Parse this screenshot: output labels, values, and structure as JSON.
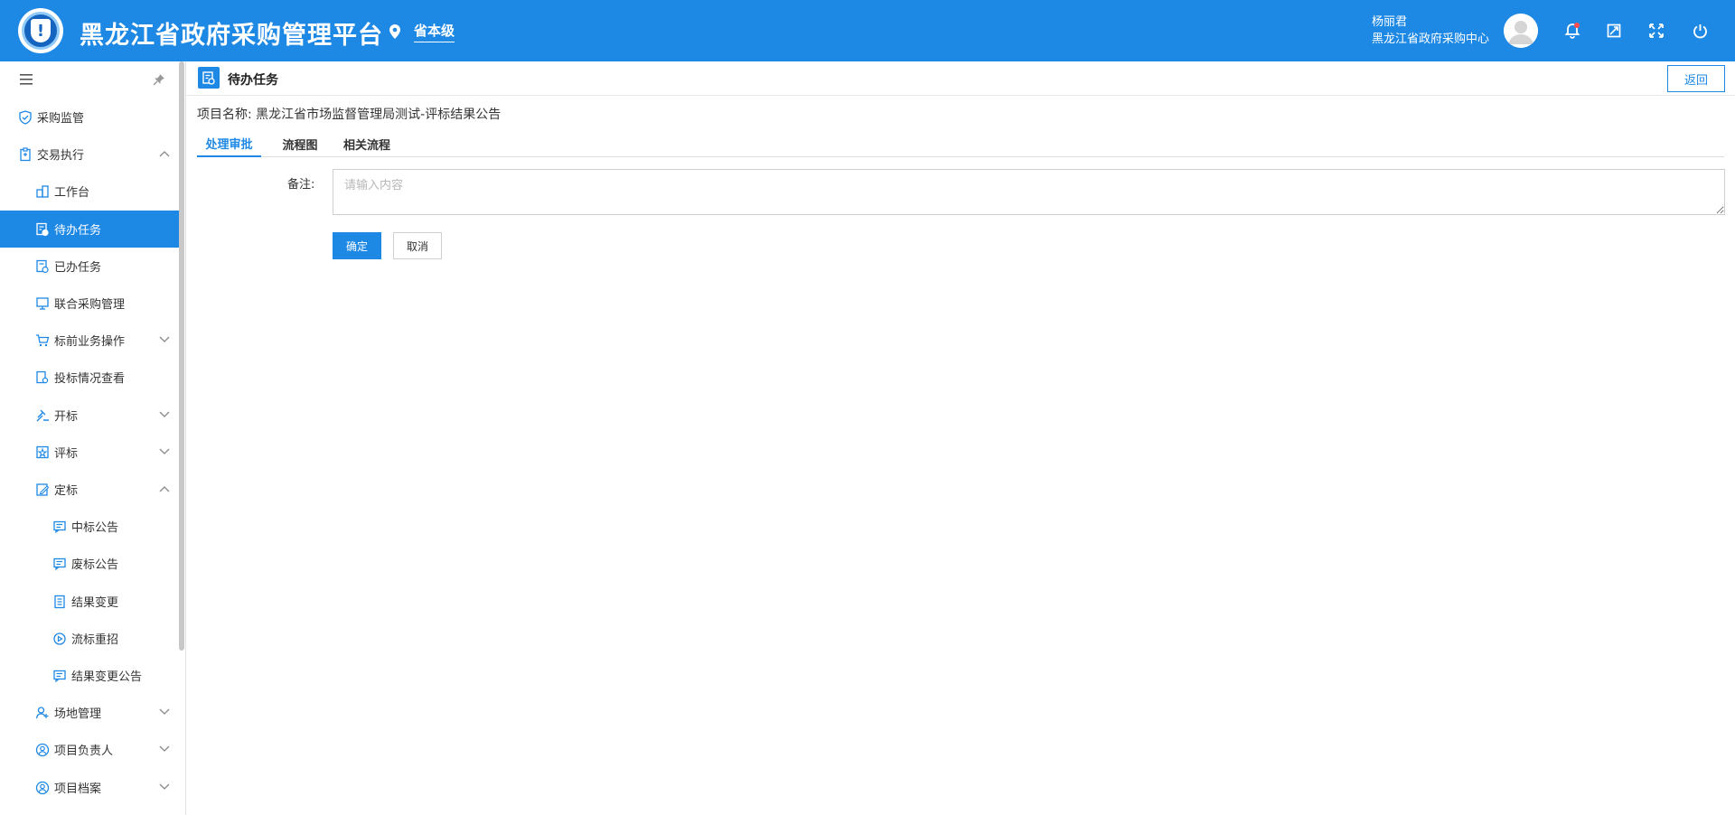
{
  "header": {
    "title": "黑龙江省政府采购管理平台",
    "region_label": "省本级",
    "user_name": "杨丽君",
    "user_org": "黑龙江省政府采购中心",
    "icons": [
      "location-icon",
      "bell-icon",
      "screenshot-icon",
      "fullscreen-icon",
      "power-icon"
    ],
    "notification_dot_color": "#ff4d4f"
  },
  "sidebar": {
    "items": [
      {
        "label": "采购监管",
        "icon": "shield-check-icon",
        "level": 0
      },
      {
        "label": "交易执行",
        "icon": "clipboard-icon",
        "level": 0,
        "expanded": true
      },
      {
        "label": "工作台",
        "icon": "building-icon",
        "level": 1
      },
      {
        "label": "待办任务",
        "icon": "task-todo-icon",
        "level": 1,
        "active": true
      },
      {
        "label": "已办任务",
        "icon": "task-done-icon",
        "level": 1
      },
      {
        "label": "联合采购管理",
        "icon": "monitor-icon",
        "level": 1
      },
      {
        "label": "标前业务操作",
        "icon": "cart-icon",
        "level": 1,
        "expanded": false
      },
      {
        "label": "投标情况查看",
        "icon": "doc-search-icon",
        "level": 1
      },
      {
        "label": "开标",
        "icon": "gavel-icon",
        "level": 1,
        "expanded": false
      },
      {
        "label": "评标",
        "icon": "star-doc-icon",
        "level": 1,
        "expanded": false
      },
      {
        "label": "定标",
        "icon": "edit-doc-icon",
        "level": 1,
        "expanded": true
      },
      {
        "label": "中标公告",
        "icon": "announce-icon",
        "level": 2
      },
      {
        "label": "废标公告",
        "icon": "announce-icon",
        "level": 2
      },
      {
        "label": "结果变更",
        "icon": "list-doc-icon",
        "level": 2
      },
      {
        "label": "流标重招",
        "icon": "cycle-icon",
        "level": 2
      },
      {
        "label": "结果变更公告",
        "icon": "announce-icon",
        "level": 2
      },
      {
        "label": "场地管理",
        "icon": "user-location-icon",
        "level": 1,
        "expanded": false
      },
      {
        "label": "项目负责人",
        "icon": "user-circle-icon",
        "level": 1,
        "expanded": false
      },
      {
        "label": "项目档案",
        "icon": "user-circle-icon",
        "level": 1,
        "expanded": false
      }
    ]
  },
  "main": {
    "page_title": "待办任务",
    "back_label": "返回",
    "project_label": "项目名称:",
    "project_name": "黑龙江省市场监督管理局测试-评标结果公告",
    "tabs": [
      {
        "label": "处理审批",
        "active": true
      },
      {
        "label": "流程图",
        "active": false
      },
      {
        "label": "相关流程",
        "active": false
      }
    ],
    "form": {
      "remark_label": "备注:",
      "remark_placeholder": "请输入内容",
      "remark_value": "",
      "ok_label": "确定",
      "cancel_label": "取消"
    }
  },
  "colors": {
    "primary": "#1e88e5",
    "text": "#333333",
    "border": "#cfcfcf"
  }
}
